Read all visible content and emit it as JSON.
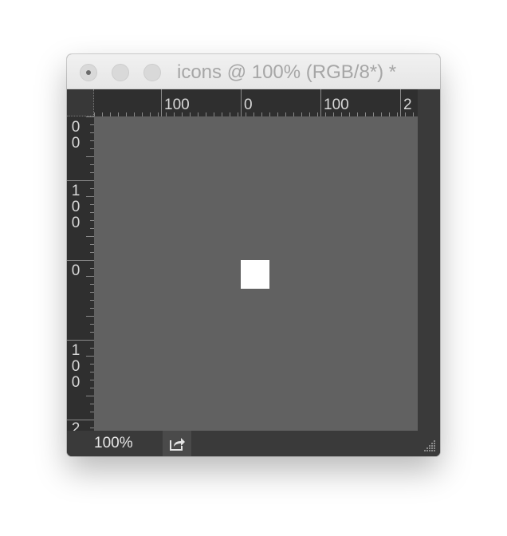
{
  "window": {
    "title": "icons @ 100% (RGB/8*) *",
    "traffic_lights": [
      "close-button",
      "minimize-button",
      "zoom-button"
    ]
  },
  "rulers": {
    "top_labels": [
      "100",
      "0",
      "100",
      "2"
    ],
    "left_labels": [
      "00",
      "100",
      "0",
      "100",
      "2"
    ]
  },
  "canvas": {
    "background": "#616161",
    "shape_color": "#ffffff"
  },
  "status": {
    "zoom": "100%",
    "share_icon": "share-icon"
  }
}
